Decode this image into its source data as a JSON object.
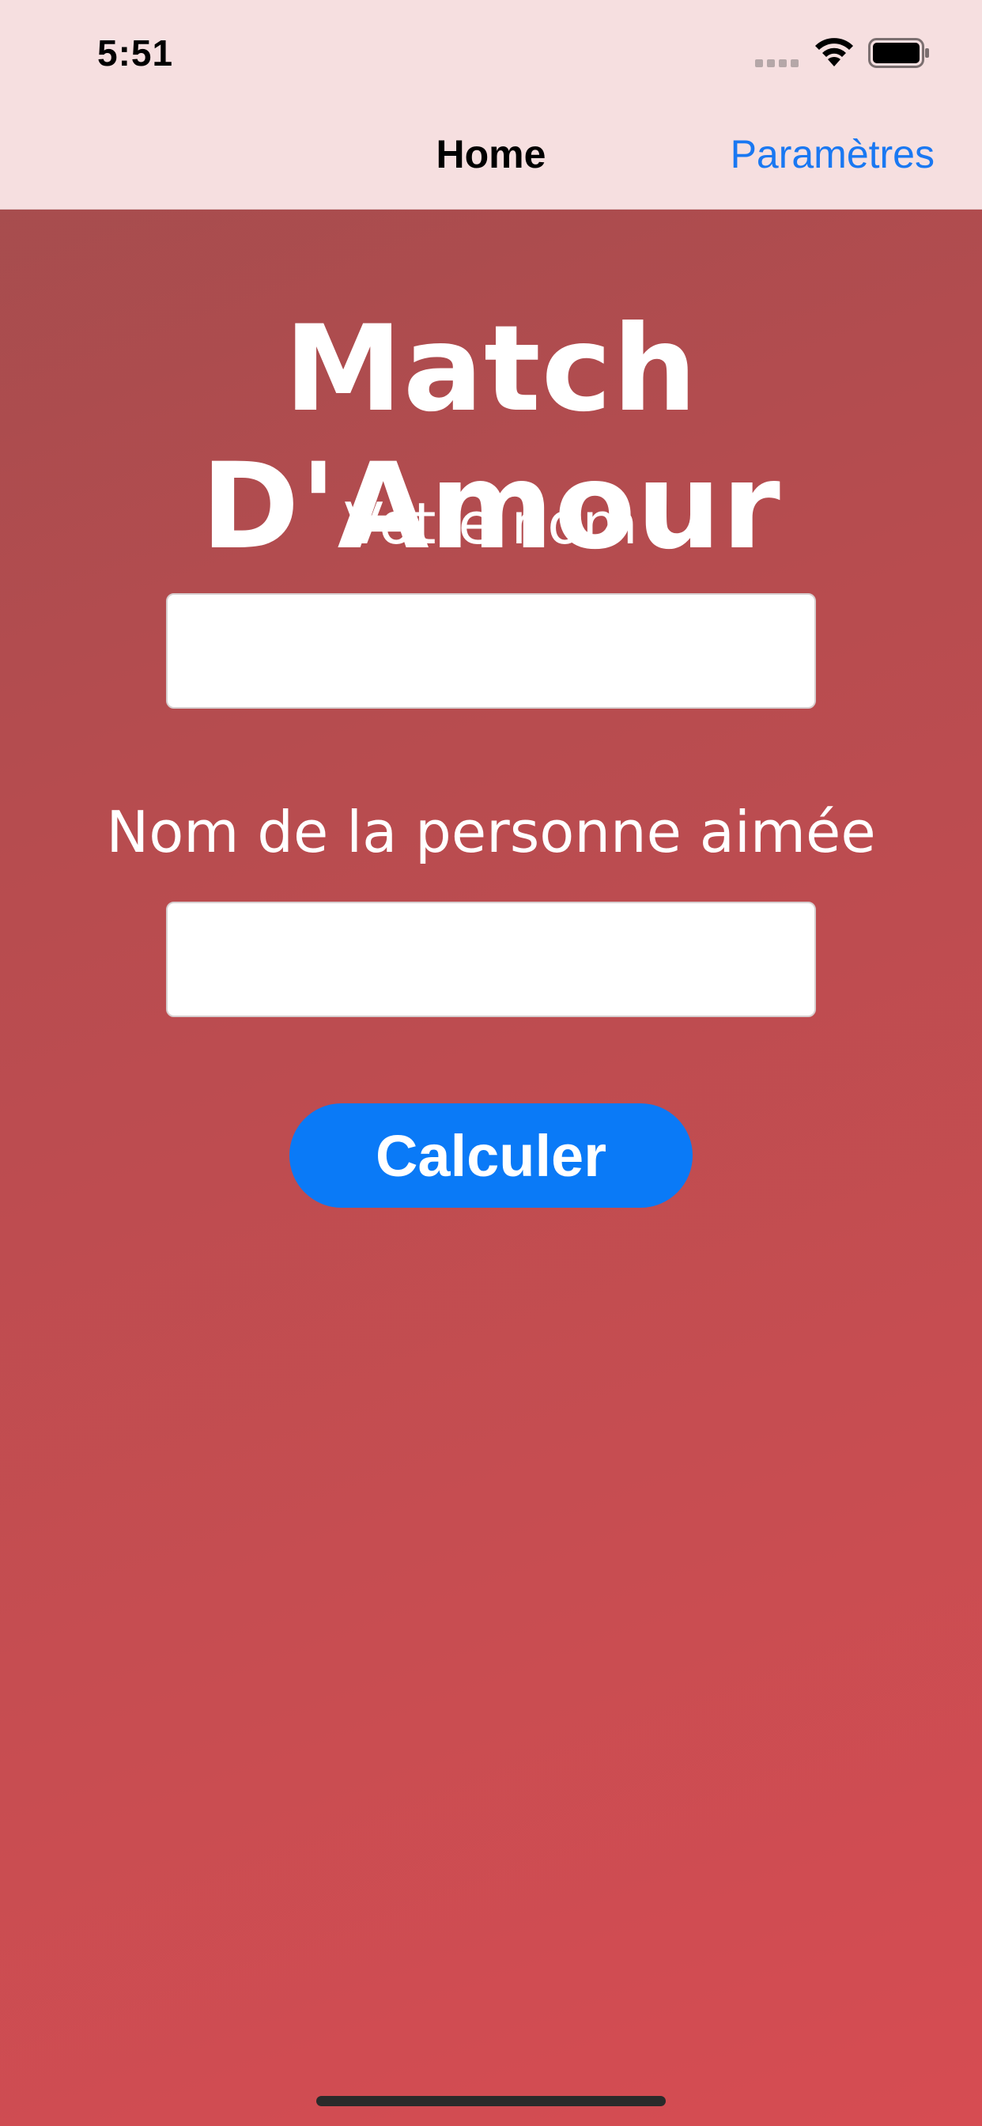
{
  "status_bar": {
    "time": "5:51"
  },
  "nav_bar": {
    "title": "Home",
    "action_label": "Paramètres"
  },
  "main": {
    "title": "Match D'Amour",
    "name_label": "Votre nom",
    "name_value": "",
    "partner_label": "Nom de la personne aimée",
    "partner_value": "",
    "calculate_label": "Calculer"
  },
  "colors": {
    "background_start": "#a24d4e",
    "background_end": "#d64c52",
    "nav_background": "#f6dfe0",
    "accent_blue": "#0a7af7",
    "link_blue": "#1a78f2"
  },
  "icons": [
    "signal-icon",
    "wifi-icon",
    "battery-icon"
  ]
}
